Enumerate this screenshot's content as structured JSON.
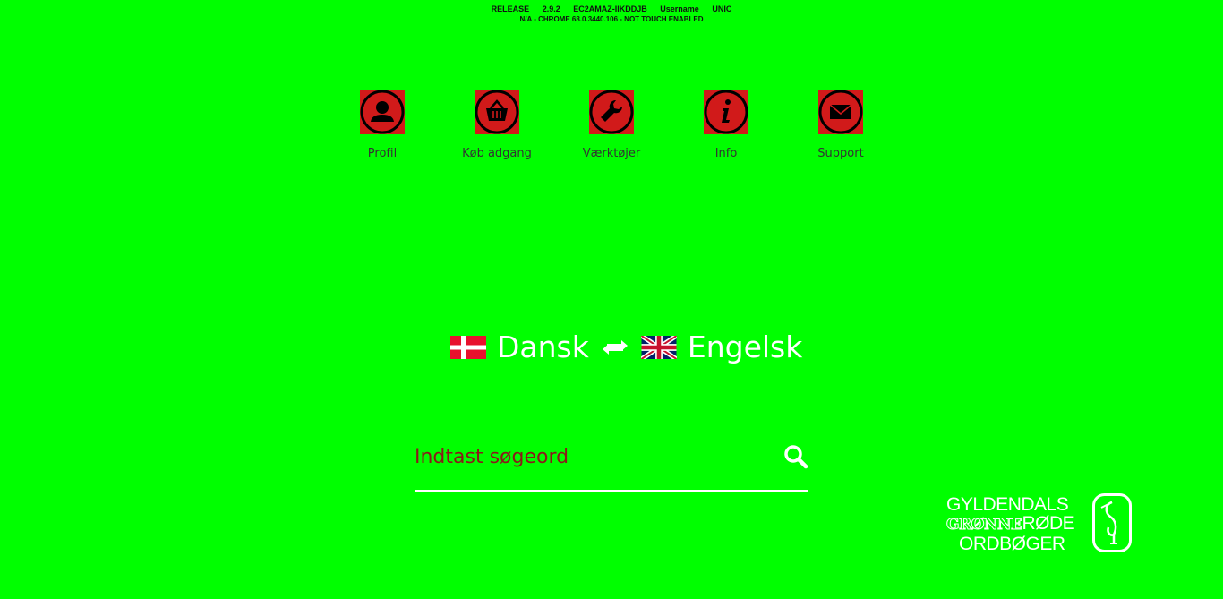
{
  "debug": {
    "release": "RELEASE",
    "version": "2.9.2",
    "host": "EC2AMAZ-IIKDDJB",
    "username": "Username",
    "org": "UNIC",
    "browser_info": "N/A - CHROME 68.0.3440.106 - NOT TOUCH ENABLED"
  },
  "nav": {
    "items": [
      {
        "label": "Profil",
        "icon": "user-icon"
      },
      {
        "label": "Køb adgang",
        "icon": "basket-icon"
      },
      {
        "label": "Værktøjer",
        "icon": "wrench-icon"
      },
      {
        "label": "Info",
        "icon": "info-icon"
      },
      {
        "label": "Support",
        "icon": "envelope-icon"
      }
    ]
  },
  "language": {
    "source": "Dansk",
    "target": "Engelsk",
    "source_flag": "danish-flag-icon",
    "target_flag": "uk-flag-icon"
  },
  "search": {
    "placeholder": "Indtast søgeord",
    "value": ""
  },
  "logo": {
    "line1": "GYLDENDALS",
    "line2_outline": "GRØNNE",
    "line2": "RØDE",
    "line3": "ORDBØGER"
  },
  "colors": {
    "background": "#00ff00",
    "icon_bg": "#d11a1a",
    "placeholder": "#8b1a1a",
    "foreground": "#ffffff"
  }
}
